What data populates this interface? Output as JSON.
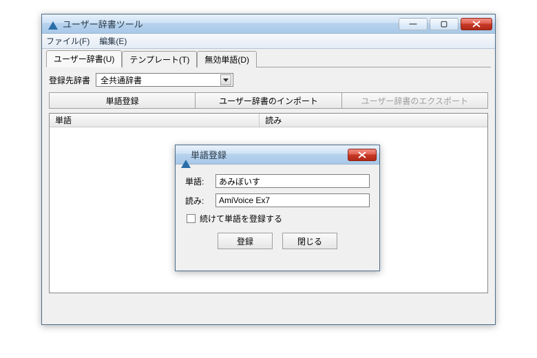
{
  "main": {
    "title": "ユーザー辞書ツール",
    "menu": {
      "file": "ファイル(F)",
      "edit": "編集(E)"
    },
    "tabs": [
      {
        "label": "ユーザー辞書(U)"
      },
      {
        "label": "テンプレート(T)"
      },
      {
        "label": "無効単語(D)"
      }
    ],
    "dict_label": "登録先辞書",
    "dict_value": "全共通辞書",
    "buttons": {
      "register": "単語登録",
      "import": "ユーザー辞書のインポート",
      "export": "ユーザー辞書のエクスポート"
    },
    "columns": {
      "word": "単語",
      "reading": "読み"
    }
  },
  "dialog": {
    "title": "単語登録",
    "word_label": "単語:",
    "word_value": "あみぼいす",
    "reading_label": "読み:",
    "reading_value": "AmiVoice Ex7",
    "continue_label": "続けて単語を登録する",
    "register": "登録",
    "close": "閉じる"
  }
}
